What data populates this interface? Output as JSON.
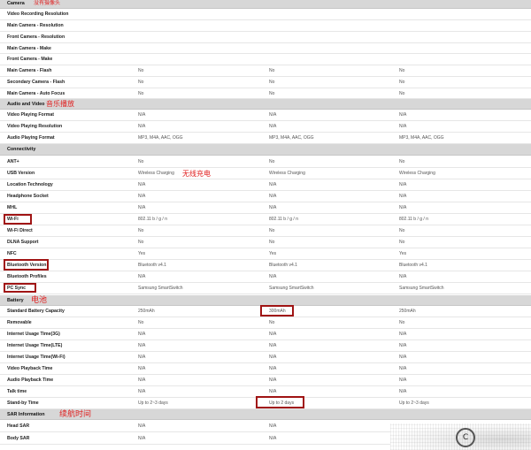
{
  "sections": {
    "camera": "Camera",
    "audio_video": "Audio and Video",
    "connectivity": "Connectivity",
    "battery": "Battery",
    "sar": "SAR Information"
  },
  "rows": {
    "video_recording_resolution": {
      "label": "Video Recording Resolution",
      "v1": "",
      "v2": "",
      "v3": ""
    },
    "main_camera_resolution": {
      "label": "Main Camera - Resolution",
      "v1": "",
      "v2": "",
      "v3": ""
    },
    "front_camera_resolution": {
      "label": "Front Camera - Resolution",
      "v1": "",
      "v2": "",
      "v3": ""
    },
    "main_camera_make": {
      "label": "Main Camera - Make",
      "v1": "",
      "v2": "",
      "v3": ""
    },
    "front_camera_make": {
      "label": "Front Camera - Make",
      "v1": "",
      "v2": "",
      "v3": ""
    },
    "main_camera_flash": {
      "label": "Main Camera - Flash",
      "v1": "No",
      "v2": "No",
      "v3": "No"
    },
    "secondary_camera_flash": {
      "label": "Secondary Camera - Flash",
      "v1": "No",
      "v2": "No",
      "v3": "No"
    },
    "main_camera_autofocus": {
      "label": "Main Camera - Auto Focus",
      "v1": "No",
      "v2": "No",
      "v3": "No"
    },
    "video_playing_format": {
      "label": "Video Playing Format",
      "v1": "N/A",
      "v2": "N/A",
      "v3": "N/A"
    },
    "video_playing_resolution": {
      "label": "Video Playing Resolution",
      "v1": "N/A",
      "v2": "N/A",
      "v3": "N/A"
    },
    "audio_playing_format": {
      "label": "Audio Playing Format",
      "v1": "MP3, M4A, AAC, OGG",
      "v2": "MP3, M4A, AAC, OGG",
      "v3": "MP3, M4A, AAC, OGG"
    },
    "ant_plus": {
      "label": "ANT+",
      "v1": "No",
      "v2": "No",
      "v3": "No"
    },
    "usb_version": {
      "label": "USB Version",
      "v1": "Wireless Charging",
      "v2": "Wireless Charging",
      "v3": "Wireless Charging"
    },
    "location_technology": {
      "label": "Location Technology",
      "v1": "N/A",
      "v2": "N/A",
      "v3": "N/A"
    },
    "headphone_socket": {
      "label": "Headphone Socket",
      "v1": "N/A",
      "v2": "N/A",
      "v3": "N/A"
    },
    "mhl": {
      "label": "MHL",
      "v1": "N/A",
      "v2": "N/A",
      "v3": "N/A"
    },
    "wifi": {
      "label": "Wi-Fi",
      "v1": "802.11 b / g / n",
      "v2": "802.11 b / g / n",
      "v3": "802.11 b / g / n"
    },
    "wifi_direct": {
      "label": "Wi-Fi Direct",
      "v1": "No",
      "v2": "No",
      "v3": "No"
    },
    "dlna_support": {
      "label": "DLNA Support",
      "v1": "No",
      "v2": "No",
      "v3": "No"
    },
    "nfc": {
      "label": "NFC",
      "v1": "Yes",
      "v2": "Yes",
      "v3": "Yes"
    },
    "bluetooth_version": {
      "label": "Bluetooth Version",
      "v1": "Bluetooth v4.1",
      "v2": "Bluetooth v4.1",
      "v3": "Bluetooth v4.1"
    },
    "bluetooth_profiles": {
      "label": "Bluetooth Profiles",
      "v1": "N/A",
      "v2": "N/A",
      "v3": "N/A"
    },
    "pc_sync": {
      "label": "PC Sync",
      "v1": "Samsung SmartSwitch",
      "v2": "Samsung SmartSwitch",
      "v3": "Samsung SmartSwitch"
    },
    "standard_battery_capacity": {
      "label": "Standard Battery Capacity",
      "v1": "250mAh",
      "v2": "300mAh",
      "v3": "250mAh"
    },
    "removable": {
      "label": "Removable",
      "v1": "No",
      "v2": "No",
      "v3": "No"
    },
    "internet_usage_3g": {
      "label": "Internet Usage Time(3G)",
      "v1": "N/A",
      "v2": "N/A",
      "v3": "N/A"
    },
    "internet_usage_lte": {
      "label": "Internet Usage Time(LTE)",
      "v1": "N/A",
      "v2": "N/A",
      "v3": "N/A"
    },
    "internet_usage_wifi": {
      "label": "Internet Usage Time(Wi-Fi)",
      "v1": "N/A",
      "v2": "N/A",
      "v3": "N/A"
    },
    "video_playback_time": {
      "label": "Video Playback Time",
      "v1": "N/A",
      "v2": "N/A",
      "v3": "N/A"
    },
    "audio_playback_time": {
      "label": "Audio Playback Time",
      "v1": "N/A",
      "v2": "N/A",
      "v3": "N/A"
    },
    "talk_time": {
      "label": "Talk time",
      "v1": "N/A",
      "v2": "N/A",
      "v3": "N/A"
    },
    "standby_time": {
      "label": "Stand-by Time",
      "v1": "Up to 2~3 days",
      "v2": "Up to 2 days",
      "v3": "Up to 2~3 days"
    },
    "head_sar": {
      "label": "Head SAR",
      "v1": "N/A",
      "v2": "N/A",
      "v3": ""
    },
    "body_sar": {
      "label": "Body SAR",
      "v1": "N/A",
      "v2": "N/A",
      "v3": ""
    }
  },
  "annotations": {
    "no_camera": "没有摄像头",
    "music_playback": "音乐播放",
    "wireless_charging": "无线充电",
    "battery": "电池",
    "battery_life": "续航时间"
  },
  "watermark": {
    "glyph": "C"
  },
  "colors": {
    "section_bg": "#d7d7d7",
    "annotation_text": "#e02020",
    "highlight_box": "#a01414"
  }
}
